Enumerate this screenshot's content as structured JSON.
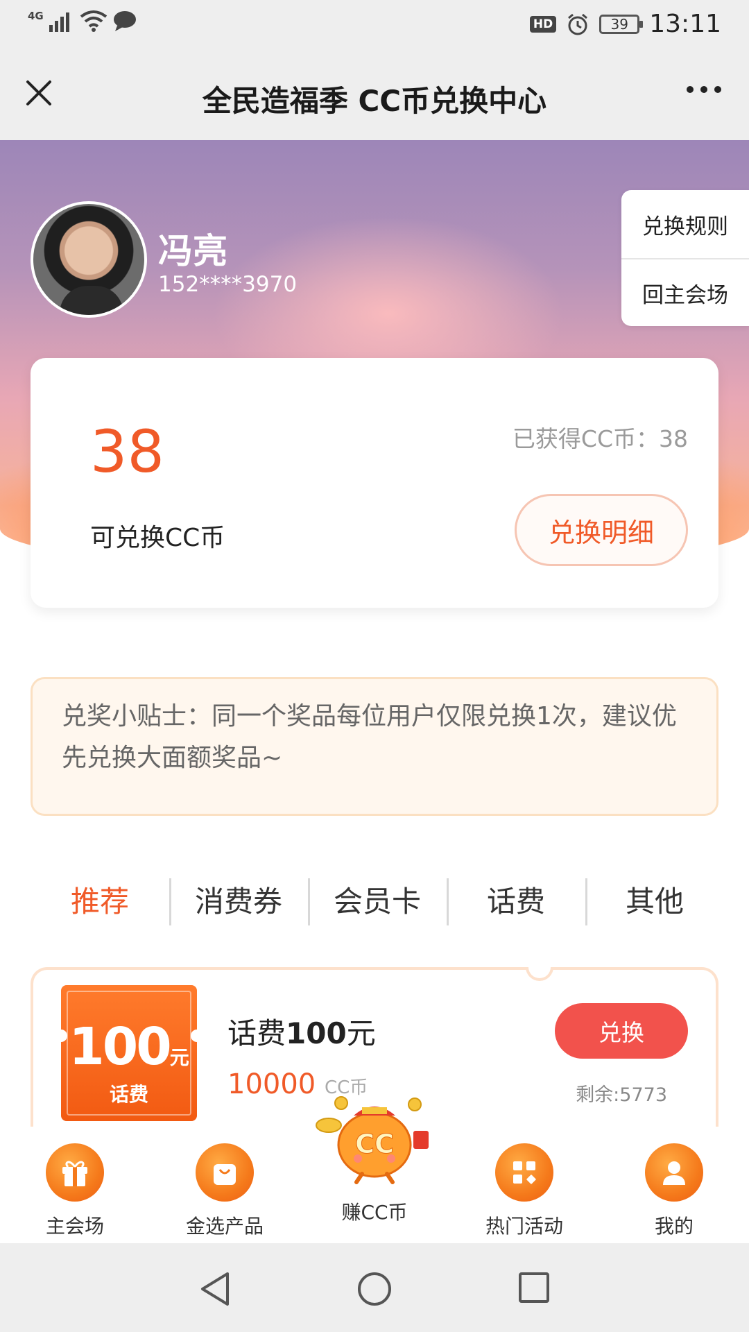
{
  "status_bar": {
    "network": "4G",
    "battery": "39",
    "time": "13:11",
    "hd_badge": "HD"
  },
  "titlebar": {
    "title": "全民造福季 CC币兑换中心"
  },
  "user": {
    "name": "冯亮",
    "phone": "152****3970"
  },
  "side_menu": {
    "rules": "兑换规则",
    "back_main": "回主会场"
  },
  "balance": {
    "amount": "38",
    "label": "可兑换CC币",
    "earned": "已获得CC币：38",
    "detail_button": "兑换明细"
  },
  "tip": {
    "text": "兑奖小贴士：同一个奖品每位用户仅限兑换1次，建议优先兑换大面额奖品~"
  },
  "tabs": [
    {
      "label": "推荐",
      "active": true
    },
    {
      "label": "消费券",
      "active": false
    },
    {
      "label": "会员卡",
      "active": false
    },
    {
      "label": "话费",
      "active": false
    },
    {
      "label": "其他",
      "active": false
    }
  ],
  "product": {
    "coupon_amount": "100",
    "coupon_unit": "元",
    "coupon_label": "话费",
    "title_prefix": "话费",
    "title_amount": "100",
    "title_suffix": "元",
    "price": "10000",
    "price_unit": "CC币",
    "button": "兑换",
    "remain": "剩余:5773"
  },
  "bottom_nav": [
    {
      "label": "主会场",
      "icon": "gift-icon"
    },
    {
      "label": "金选产品",
      "icon": "shopping-bag-icon"
    },
    {
      "label": "赚CC币",
      "icon": "coin-mascot-icon"
    },
    {
      "label": "热门活动",
      "icon": "apps-grid-icon"
    },
    {
      "label": "我的",
      "icon": "user-icon"
    }
  ],
  "colors": {
    "accent": "#f05a28",
    "button_red": "#f2524c",
    "nav_orange": "#f57a1b",
    "tip_bg": "#fff7ee"
  }
}
